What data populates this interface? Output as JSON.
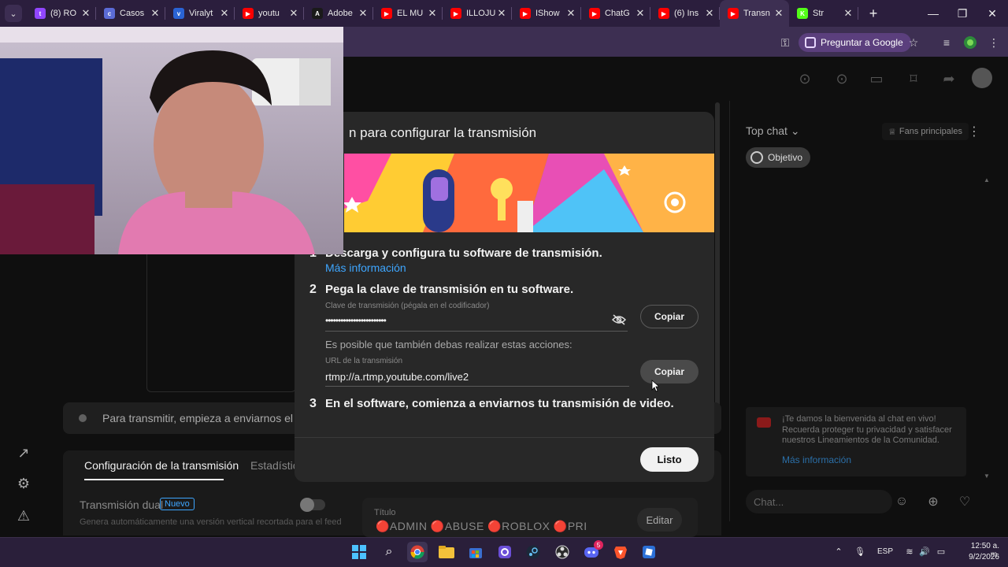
{
  "browser": {
    "tabs": [
      {
        "label": "(8) RO",
        "color": "#9146ff",
        "glyph": "t",
        "active": false
      },
      {
        "label": "Casos",
        "color": "#5b6bd6",
        "glyph": "c",
        "active": false
      },
      {
        "label": "Viralyt",
        "color": "#2a63d4",
        "glyph": "v",
        "active": false
      },
      {
        "label": "youtu",
        "color": "#ff0000",
        "glyph": "▶",
        "active": false
      },
      {
        "label": "Adobe",
        "color": "#1a1a1a",
        "glyph": "A",
        "active": false
      },
      {
        "label": "EL MU",
        "color": "#ff0000",
        "glyph": "▶",
        "active": false
      },
      {
        "label": "ILLOJU",
        "color": "#ff0000",
        "glyph": "▶",
        "active": false
      },
      {
        "label": "IShow",
        "color": "#ff0000",
        "glyph": "▶",
        "active": false
      },
      {
        "label": "ChatG",
        "color": "#ff0000",
        "glyph": "▶",
        "active": false
      },
      {
        "label": "(6) Ins",
        "color": "#ff0000",
        "glyph": "▶",
        "active": false
      },
      {
        "label": "Transn",
        "color": "#ff0000",
        "glyph": "▶",
        "active": true
      },
      {
        "label": "Str",
        "color": "#53fc18",
        "glyph": "K",
        "active": false
      }
    ],
    "ask_google_label": "Preguntar a Google"
  },
  "modal": {
    "title": "n para configurar la transmisión",
    "step1_num": "1",
    "step1_text": "Descarga y configura tu software de transmisión.",
    "more_info": "Más información",
    "step2_num": "2",
    "step2_text": "Pega la clave de transmisión en tu software.",
    "key_label": "Clave de transmisión (pégala en el codificador)",
    "key_value": "••••••••••••••••••••••••",
    "copy_label": "Copiar",
    "hint": "Es posible que también debas realizar estas acciones:",
    "url_label": "URL de la transmisión",
    "url_value": "rtmp://a.rtmp.youtube.com/live2",
    "step3_num": "3",
    "step3_text": "En el software, comienza a enviarnos tu transmisión de video.",
    "done_label": "Listo"
  },
  "studio": {
    "status_text": "Para transmitir, empieza a enviarnos el v",
    "tab_config": "Configuración de la transmisión",
    "tab_stats": "Estadístic",
    "dual_label": "Transmisión dual",
    "new_badge": "Nuevo",
    "dual_desc": "Genera automáticamente una versión vertical recortada para el feed",
    "title_label": "Título",
    "title_value": "🔴ADMIN 🔴ABUSE 🔴ROBLOX 🔴PRI",
    "edit_label": "Editar"
  },
  "chat": {
    "header": "Top chat",
    "fans_label": "Fans principales",
    "objective_label": "Objetivo",
    "welcome_text": "¡Te damos la bienvenida al chat en vivo! Recuerda proteger tu privacidad y satisfacer nuestros Lineamientos de la Comunidad.",
    "welcome_link": "Más información",
    "input_placeholder": "Chat..."
  },
  "taskbar": {
    "language": "ESP",
    "time": "12:50 a. m.",
    "date": "9/2/2026",
    "discord_badge": "5"
  }
}
